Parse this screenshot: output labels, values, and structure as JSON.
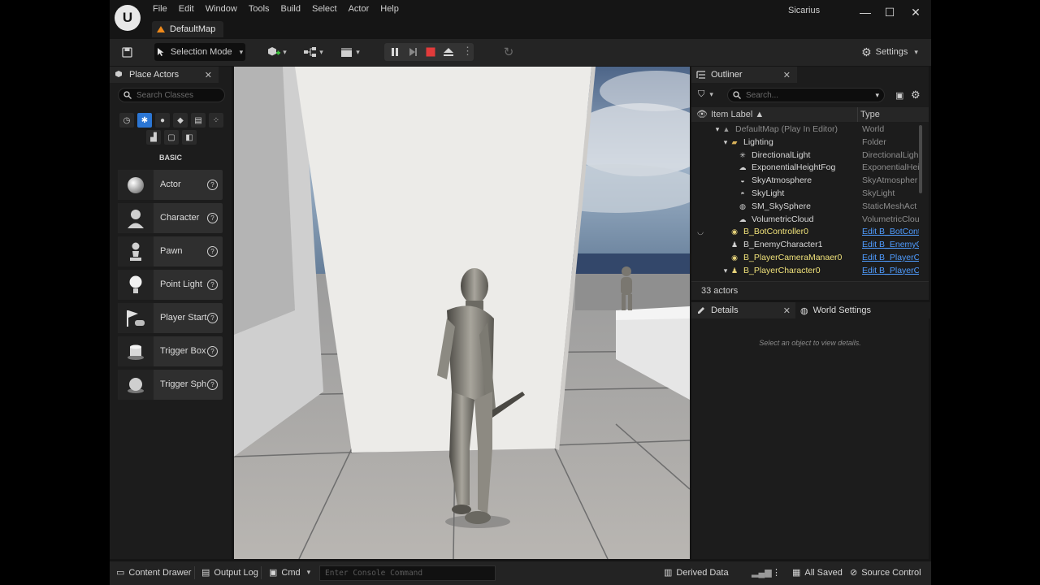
{
  "window": {
    "project_name": "Sicarius",
    "document_tab": "DefaultMap",
    "menu": [
      "File",
      "Edit",
      "Window",
      "Tools",
      "Build",
      "Select",
      "Actor",
      "Help"
    ]
  },
  "toolbar": {
    "selection_mode": "Selection Mode",
    "settings": "Settings"
  },
  "place_actors": {
    "tab_title": "Place Actors",
    "search_placeholder": "Search Classes",
    "category_label": "BASIC",
    "items": [
      {
        "label": "Actor"
      },
      {
        "label": "Character"
      },
      {
        "label": "Pawn"
      },
      {
        "label": "Point Light"
      },
      {
        "label": "Player Start"
      },
      {
        "label": "Trigger Box"
      },
      {
        "label": "Trigger Sph"
      }
    ]
  },
  "outliner": {
    "tab_title": "Outliner",
    "search_placeholder": "Search...",
    "col_label": "Item Label ▲",
    "col_type": "Type",
    "rows": [
      {
        "label": "DefaultMap (Play In Editor)",
        "type": "World"
      },
      {
        "label": "Lighting",
        "type": "Folder"
      },
      {
        "label": "DirectionalLight",
        "type": "DirectionalLigh"
      },
      {
        "label": "ExponentialHeightFog",
        "type": "ExponentialHei"
      },
      {
        "label": "SkyAtmosphere",
        "type": "SkyAtmospher"
      },
      {
        "label": "SkyLight",
        "type": "SkyLight"
      },
      {
        "label": "SM_SkySphere",
        "type": "StaticMeshAct"
      },
      {
        "label": "VolumetricCloud",
        "type": "VolumetricClou"
      },
      {
        "label": "B_BotController0",
        "type": "Edit B_BotCont"
      },
      {
        "label": "B_EnemyCharacter1",
        "type": "Edit B_EnemyC"
      },
      {
        "label": "B_PlayerCameraManaer0",
        "type": "Edit B_PlayerC"
      },
      {
        "label": "B_PlayerCharacter0",
        "type": "Edit B_PlayerC"
      }
    ],
    "actor_count": "33 actors"
  },
  "details": {
    "tab_title": "Details",
    "world_settings_tab": "World Settings",
    "hint": "Select an object to view details."
  },
  "statusbar": {
    "content_drawer": "Content Drawer",
    "output_log": "Output Log",
    "cmd": "Cmd",
    "console_placeholder": "Enter Console Command",
    "derived_data": "Derived Data",
    "all_saved": "All Saved",
    "source_control": "Source Control"
  },
  "colors": {
    "accent_blue": "#2b76d4",
    "link_blue": "#4f9cff",
    "stop_red": "#e23b3b",
    "map_orange": "#f08a1a"
  }
}
